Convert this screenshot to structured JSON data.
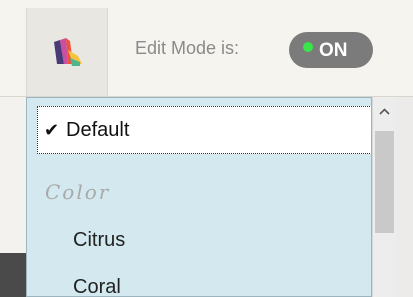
{
  "toolbar": {
    "palette_icon": "color-palette-icon",
    "edit_mode_label": "Edit Mode is:",
    "toggle_state": "ON",
    "toggle_indicator_color": "#39e54a"
  },
  "dropdown": {
    "selected": "Default",
    "check_icon": "checkmark-icon",
    "options": {
      "default": "Default",
      "group_label": "Color",
      "citrus": "Citrus",
      "coral": "Coral"
    },
    "background_color": "#d3e9ef"
  },
  "scrollbar": {
    "up_arrow_icon": "chevron-up-icon"
  }
}
